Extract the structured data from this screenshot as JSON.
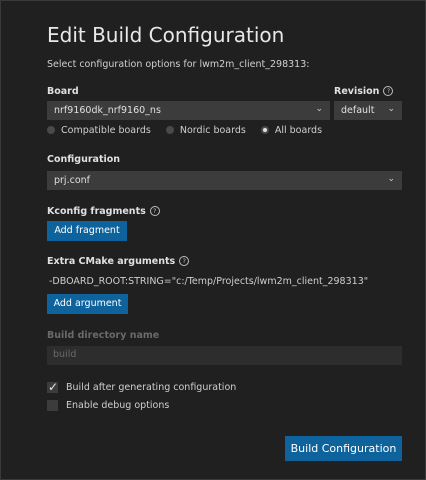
{
  "header": {
    "title": "Edit Build Configuration",
    "subtitle": "Select configuration options for lwm2m_client_298313:"
  },
  "board": {
    "label": "Board",
    "value": "nrf9160dk_nrf9160_ns",
    "filters": [
      {
        "label": "Compatible boards",
        "selected": false
      },
      {
        "label": "Nordic boards",
        "selected": false
      },
      {
        "label": "All boards",
        "selected": true
      }
    ]
  },
  "revision": {
    "label": "Revision",
    "value": "default"
  },
  "configuration": {
    "label": "Configuration",
    "value": "prj.conf"
  },
  "kconfig": {
    "label": "Kconfig fragments",
    "button": "Add fragment"
  },
  "cmake": {
    "label": "Extra CMake arguments",
    "argument": "-DBOARD_ROOT:STRING=\"c:/Temp/Projects/lwm2m_client_298313\"",
    "button": "Add argument"
  },
  "build_dir": {
    "label": "Build directory name",
    "value": "build"
  },
  "options": {
    "build_after": {
      "label": "Build after generating configuration",
      "checked": true
    },
    "debug": {
      "label": "Enable debug options",
      "checked": false
    }
  },
  "footer": {
    "build_button": "Build Configuration"
  },
  "icons": {
    "help": "help-circle-icon",
    "chevron": "chevron-down-icon",
    "check": "checkmark-icon"
  },
  "colors": {
    "accent": "#0e639c",
    "background": "#202020",
    "input": "#3c3c3c"
  }
}
